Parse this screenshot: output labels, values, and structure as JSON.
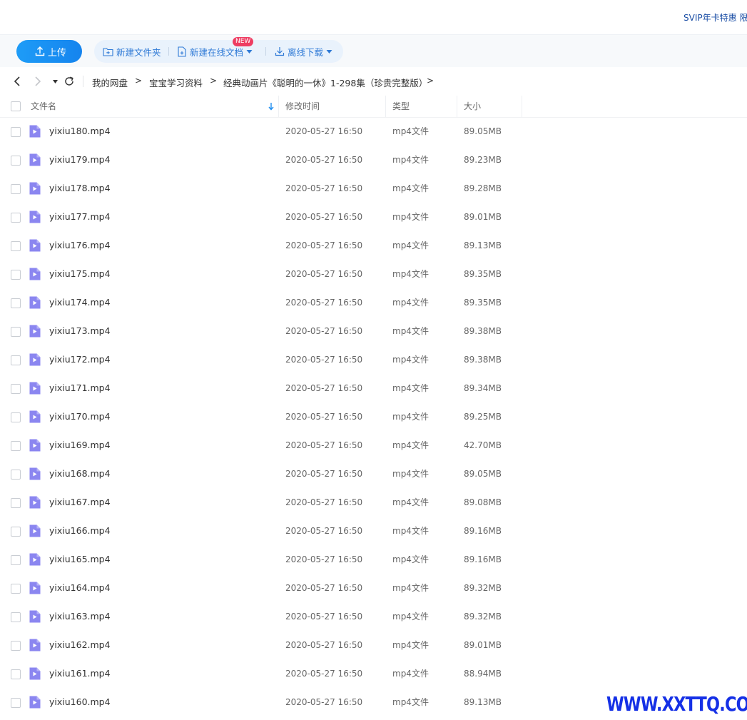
{
  "topbar": {
    "promo": "SVIP年卡特惠 限"
  },
  "toolbar": {
    "upload_label": "上传",
    "new_folder_label": "新建文件夹",
    "new_online_doc_label": "新建在线文档",
    "new_badge": "NEW",
    "offline_download_label": "离线下载"
  },
  "breadcrumb": {
    "items": [
      "我的网盘",
      "宝宝学习资料",
      "经典动画片《聪明的一休》1-298集（珍贵完整版）"
    ],
    "separator": ">"
  },
  "table": {
    "columns": {
      "name": "文件名",
      "modified": "修改时间",
      "type": "类型",
      "size": "大小"
    },
    "rows": [
      {
        "name": "yixiu180.mp4",
        "modified": "2020-05-27 16:50",
        "type": "mp4文件",
        "size": "89.05MB"
      },
      {
        "name": "yixiu179.mp4",
        "modified": "2020-05-27 16:50",
        "type": "mp4文件",
        "size": "89.23MB"
      },
      {
        "name": "yixiu178.mp4",
        "modified": "2020-05-27 16:50",
        "type": "mp4文件",
        "size": "89.28MB"
      },
      {
        "name": "yixiu177.mp4",
        "modified": "2020-05-27 16:50",
        "type": "mp4文件",
        "size": "89.01MB"
      },
      {
        "name": "yixiu176.mp4",
        "modified": "2020-05-27 16:50",
        "type": "mp4文件",
        "size": "89.13MB"
      },
      {
        "name": "yixiu175.mp4",
        "modified": "2020-05-27 16:50",
        "type": "mp4文件",
        "size": "89.35MB"
      },
      {
        "name": "yixiu174.mp4",
        "modified": "2020-05-27 16:50",
        "type": "mp4文件",
        "size": "89.35MB"
      },
      {
        "name": "yixiu173.mp4",
        "modified": "2020-05-27 16:50",
        "type": "mp4文件",
        "size": "89.38MB"
      },
      {
        "name": "yixiu172.mp4",
        "modified": "2020-05-27 16:50",
        "type": "mp4文件",
        "size": "89.38MB"
      },
      {
        "name": "yixiu171.mp4",
        "modified": "2020-05-27 16:50",
        "type": "mp4文件",
        "size": "89.34MB"
      },
      {
        "name": "yixiu170.mp4",
        "modified": "2020-05-27 16:50",
        "type": "mp4文件",
        "size": "89.25MB"
      },
      {
        "name": "yixiu169.mp4",
        "modified": "2020-05-27 16:50",
        "type": "mp4文件",
        "size": "42.70MB"
      },
      {
        "name": "yixiu168.mp4",
        "modified": "2020-05-27 16:50",
        "type": "mp4文件",
        "size": "89.05MB"
      },
      {
        "name": "yixiu167.mp4",
        "modified": "2020-05-27 16:50",
        "type": "mp4文件",
        "size": "89.08MB"
      },
      {
        "name": "yixiu166.mp4",
        "modified": "2020-05-27 16:50",
        "type": "mp4文件",
        "size": "89.16MB"
      },
      {
        "name": "yixiu165.mp4",
        "modified": "2020-05-27 16:50",
        "type": "mp4文件",
        "size": "89.16MB"
      },
      {
        "name": "yixiu164.mp4",
        "modified": "2020-05-27 16:50",
        "type": "mp4文件",
        "size": "89.32MB"
      },
      {
        "name": "yixiu163.mp4",
        "modified": "2020-05-27 16:50",
        "type": "mp4文件",
        "size": "89.32MB"
      },
      {
        "name": "yixiu162.mp4",
        "modified": "2020-05-27 16:50",
        "type": "mp4文件",
        "size": "89.01MB"
      },
      {
        "name": "yixiu161.mp4",
        "modified": "2020-05-27 16:50",
        "type": "mp4文件",
        "size": "88.94MB"
      },
      {
        "name": "yixiu160.mp4",
        "modified": "2020-05-27 16:50",
        "type": "mp4文件",
        "size": "89.13MB"
      }
    ]
  },
  "watermark": "WWW.XXTTQ.COM",
  "colors": {
    "accent": "#1e9cf7",
    "file_icon": "#8b86f0",
    "badge": "#ee3d62",
    "watermark": "#1530e6"
  }
}
